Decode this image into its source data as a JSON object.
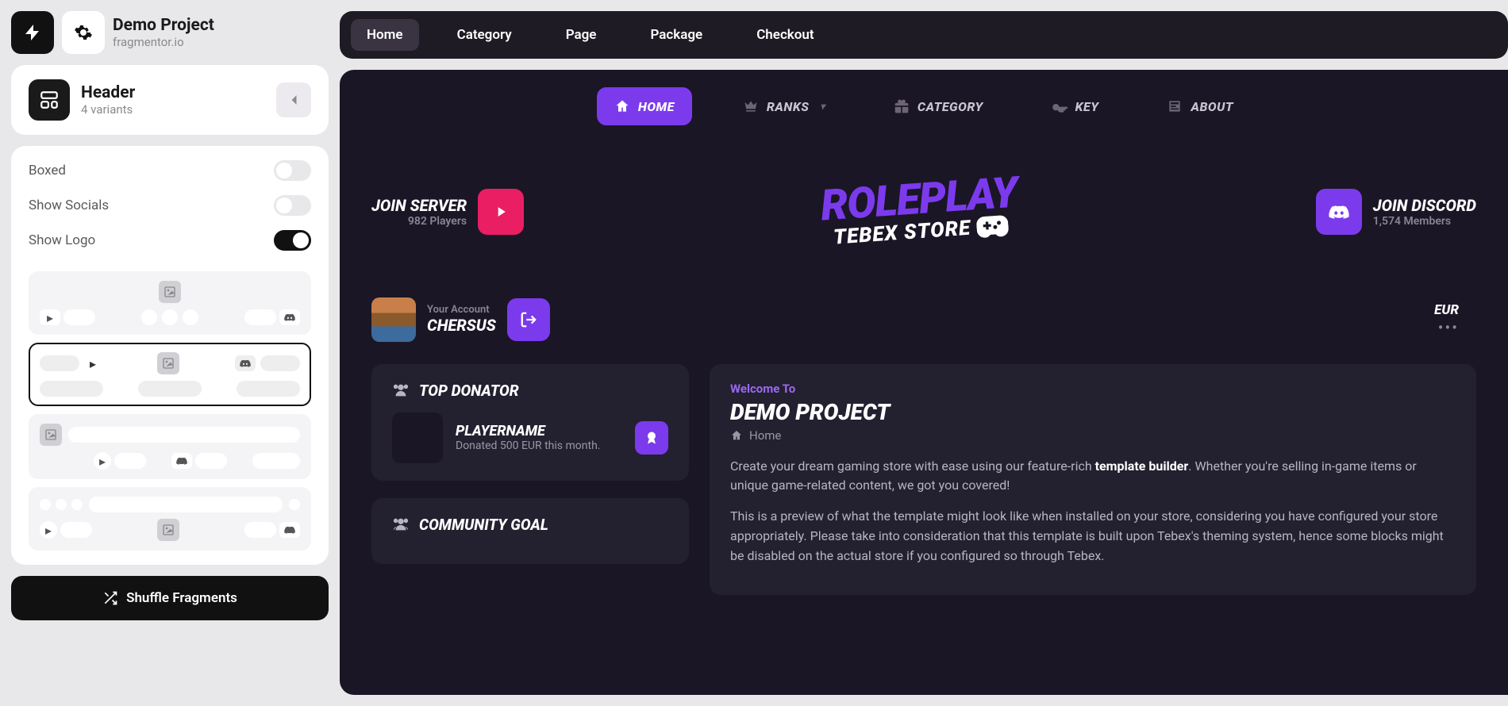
{
  "header": {
    "project_title": "Demo Project",
    "project_sub": "fragmentor.io"
  },
  "panel": {
    "title": "Header",
    "variants_label": "4 variants"
  },
  "settings": [
    {
      "label": "Boxed",
      "on": false
    },
    {
      "label": "Show Socials",
      "on": false
    },
    {
      "label": "Show Logo",
      "on": true
    }
  ],
  "shuffle_label": "Shuffle Fragments",
  "tabs": [
    "Home",
    "Category",
    "Page",
    "Package",
    "Checkout"
  ],
  "nav": [
    {
      "label": "HOME",
      "icon": "home",
      "active": true
    },
    {
      "label": "RANKS",
      "icon": "crown",
      "dropdown": true
    },
    {
      "label": "CATEGORY",
      "icon": "gift"
    },
    {
      "label": "KEY",
      "icon": "key"
    },
    {
      "label": "ABOUT",
      "icon": "news"
    }
  ],
  "hero": {
    "join_server": "JOIN SERVER",
    "players": "982 Players",
    "logo_big": "ROLEPLAY",
    "logo_sub": "TEBEX STORE",
    "join_discord": "JOIN DISCORD",
    "members": "1,574 Members"
  },
  "account": {
    "label": "Your Account",
    "name": "CHERSUS",
    "currency": "EUR"
  },
  "donator": {
    "title": "TOP DONATOR",
    "name": "PLAYERNAME",
    "sub": "Donated 500 EUR this month."
  },
  "goal": {
    "title": "COMMUNITY GOAL"
  },
  "welcome": {
    "label": "Welcome To",
    "title": "DEMO PROJECT",
    "crumb": "Home",
    "p1_a": "Create your dream gaming store with ease using our feature-rich ",
    "p1_bold": "template builder",
    "p1_b": ". Whether you're selling in-game items or unique game-related content, we got you covered!",
    "p2": "This is a preview of what the template might look like when installed on your store, considering you have configured your store appropriately. Please take into consideration that this template is built upon Tebex's theming system, hence some blocks might be disabled on the actual store if you configured so through Tebex."
  }
}
